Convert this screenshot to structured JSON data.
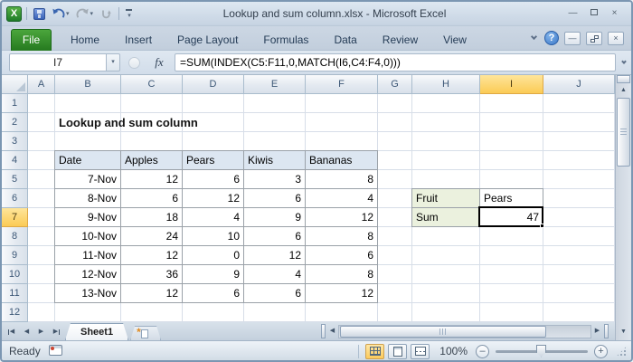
{
  "window": {
    "title": "Lookup and sum column.xlsx  -  Microsoft Excel"
  },
  "ribbon": {
    "file_tab": "File",
    "tabs": [
      "Home",
      "Insert",
      "Page Layout",
      "Formulas",
      "Data",
      "Review",
      "View"
    ]
  },
  "formula_bar": {
    "name_box": "I7",
    "fx_label": "fx",
    "formula": "=SUM(INDEX(C5:F11,0,MATCH(I6,C4:F4,0)))"
  },
  "sheet": {
    "columns": [
      "A",
      "B",
      "C",
      "D",
      "E",
      "F",
      "G",
      "H",
      "I",
      "J"
    ],
    "rows": [
      "1",
      "2",
      "3",
      "4",
      "5",
      "6",
      "7",
      "8",
      "9",
      "10",
      "11",
      "12"
    ],
    "selected": {
      "cell": "I7",
      "column": "I",
      "row": "7"
    },
    "title_cell": {
      "col": "B",
      "row": 2,
      "text": "Lookup and sum column"
    },
    "data_table": {
      "origin": {
        "col": "B",
        "row": 4
      },
      "header": [
        "Date",
        "Apples",
        "Pears",
        "Kiwis",
        "Bananas"
      ],
      "rows": [
        [
          "7-Nov",
          "12",
          "6",
          "3",
          "8"
        ],
        [
          "8-Nov",
          "6",
          "12",
          "6",
          "4"
        ],
        [
          "9-Nov",
          "18",
          "4",
          "9",
          "12"
        ],
        [
          "10-Nov",
          "24",
          "10",
          "6",
          "8"
        ],
        [
          "11-Nov",
          "12",
          "0",
          "12",
          "6"
        ],
        [
          "12-Nov",
          "36",
          "9",
          "4",
          "8"
        ],
        [
          "13-Nov",
          "12",
          "6",
          "6",
          "12"
        ]
      ]
    },
    "lookup_table": {
      "origin": {
        "col": "H",
        "row": 6
      },
      "rows": [
        [
          "Fruit",
          "Pears"
        ],
        [
          "Sum",
          "47"
        ]
      ]
    }
  },
  "sheet_bar": {
    "tabs": [
      "Sheet1"
    ],
    "active_tab": "Sheet1"
  },
  "status_bar": {
    "mode": "Ready",
    "zoom": "100%"
  },
  "colors": {
    "header_highlight": "#FBCB55",
    "table_header_fill": "#DCE6F1",
    "lookup_label_fill": "#EBF1DE",
    "file_tab_green": "#2F8C2B",
    "selection_border": "#000000"
  },
  "icons": {
    "excel_logo": "X",
    "dropdown": "▾",
    "minimize": "—",
    "close": "×",
    "help": "?",
    "scroll_up": "▲",
    "scroll_down": "▼",
    "scroll_left": "◀",
    "scroll_right": "▶",
    "nav_first": "◀",
    "nav_prev": "◀",
    "nav_next": "▶",
    "nav_last": "▶",
    "zoom_out": "–",
    "zoom_in": "+",
    "insert_sheet_star": "*"
  }
}
